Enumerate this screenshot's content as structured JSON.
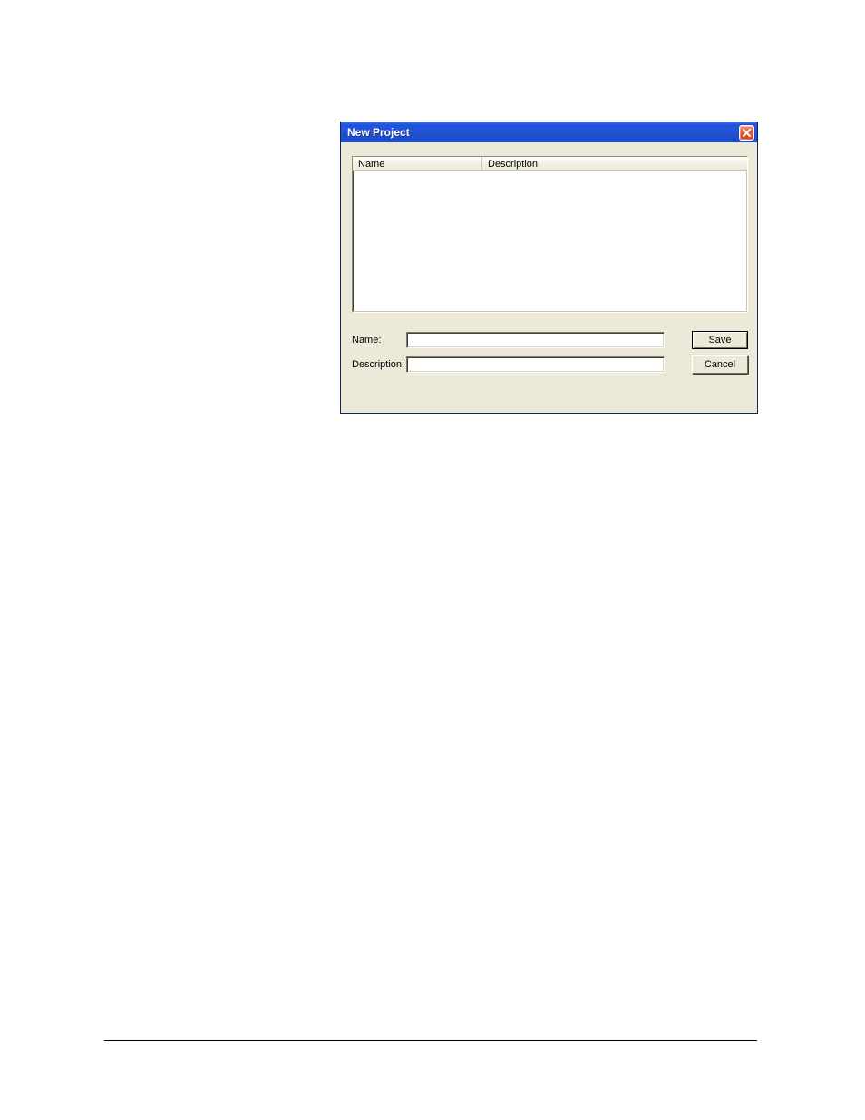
{
  "dialog": {
    "title": "New Project",
    "listview": {
      "columns": {
        "name": "Name",
        "description": "Description"
      }
    },
    "labels": {
      "name": "Name:",
      "description": "Description:"
    },
    "inputs": {
      "name_value": "",
      "description_value": ""
    },
    "buttons": {
      "save": "Save",
      "cancel": "Cancel"
    }
  }
}
